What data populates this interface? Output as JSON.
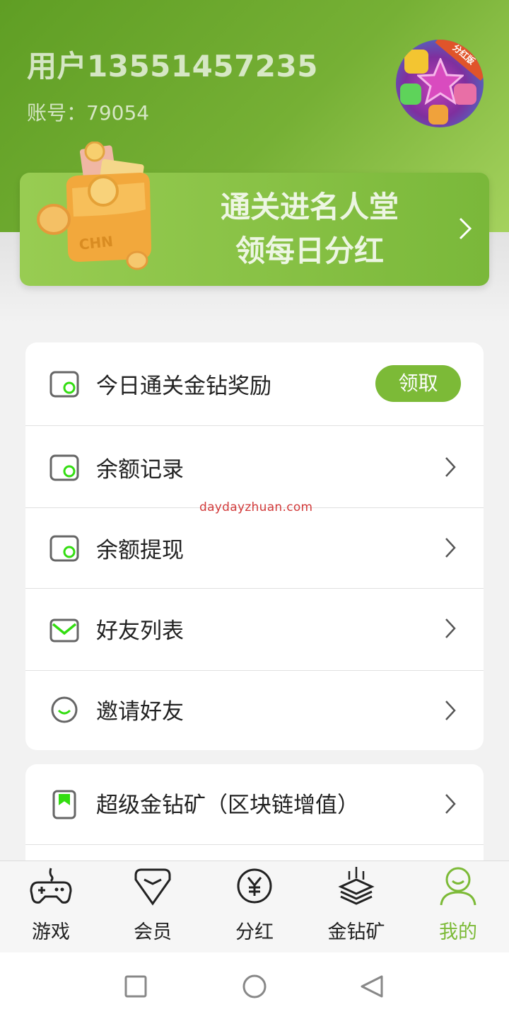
{
  "profile": {
    "username": "用户13551457235",
    "account": "账号：79054",
    "avatar_badge": "分红版"
  },
  "banner": {
    "line1": "通关进名人堂",
    "line2": "领每日分红",
    "wallet_text": "CHN"
  },
  "menu": {
    "items": [
      {
        "label": "今日通关金钻奖励",
        "icon": "wallet-icon",
        "action": "领取"
      },
      {
        "label": "余额记录",
        "icon": "wallet-icon"
      },
      {
        "label": "余额提现",
        "icon": "wallet-icon"
      },
      {
        "label": "好友列表",
        "icon": "mail-icon"
      },
      {
        "label": "邀请好友",
        "icon": "smile-icon"
      }
    ],
    "items2": [
      {
        "label": "超级金钻矿（区块链增值）",
        "icon": "bookmark-icon"
      }
    ]
  },
  "watermark": "daydayzhuan.com",
  "bottom_nav": [
    {
      "label": "游戏",
      "icon": "gamepad-icon"
    },
    {
      "label": "会员",
      "icon": "diamond-icon"
    },
    {
      "label": "分红",
      "icon": "yen-icon"
    },
    {
      "label": "金钻矿",
      "icon": "mine-stack-icon"
    },
    {
      "label": "我的",
      "icon": "person-icon",
      "active": true
    }
  ],
  "colors": {
    "accent": "#7cba37",
    "header_dark": "#5f9e24",
    "header_light": "#a5d25e",
    "icon_gray": "#666666",
    "icon_green": "#33dd11"
  }
}
